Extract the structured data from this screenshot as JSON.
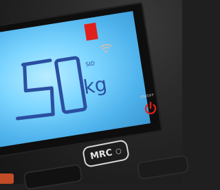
{
  "display": {
    "reading_digits": "50",
    "unit": "kg",
    "secondary_unit": "SID"
  },
  "controls": {
    "power_label": "ON/OFF",
    "mrc_label": "MRC",
    "mrc_symbol": "○"
  },
  "icons": {
    "status_bar": "red-status-bar",
    "signal": "wifi-signal-icon",
    "power": "power-icon"
  },
  "colors": {
    "lcd_backlight": "#7ed6ff",
    "segment": "#2a4fa0",
    "status_red": "#e0201c",
    "power_red": "#e0201c",
    "panel": "#2a2a2a"
  }
}
